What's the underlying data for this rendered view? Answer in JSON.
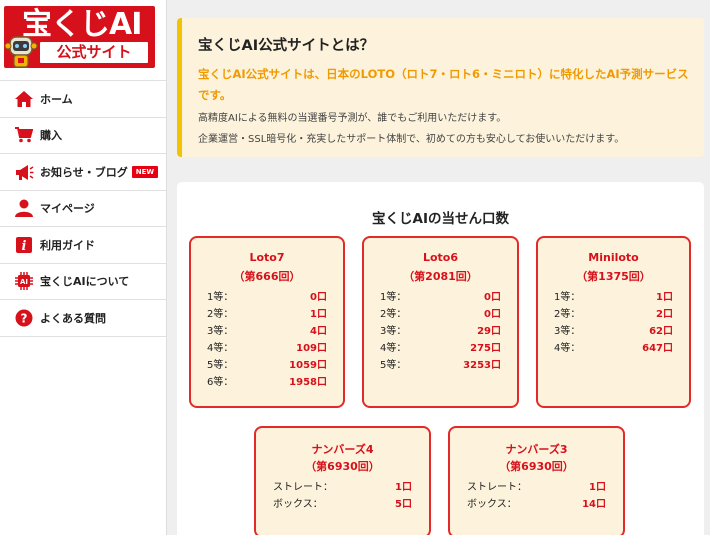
{
  "logo": {
    "main": "宝くじAI",
    "sub": "公式サイト"
  },
  "nav": [
    {
      "label": "ホーム",
      "icon": "home-icon"
    },
    {
      "label": "購入",
      "icon": "cart-icon"
    },
    {
      "label": "お知らせ・ブログ",
      "icon": "megaphone-icon",
      "badge": "NEW"
    },
    {
      "label": "マイページ",
      "icon": "user-icon"
    },
    {
      "label": "利用ガイド",
      "icon": "guide-book-icon"
    },
    {
      "label": "宝くじAIについて",
      "icon": "ai-chip-icon"
    },
    {
      "label": "よくある質問",
      "icon": "question-icon"
    }
  ],
  "intro": {
    "title": "宝くじAI公式サイトとは？",
    "lead": "宝くじAI公式サイトは、日本のLOTO（ロト7・ロト6・ミニロト）に特化したAI予測サービスです。",
    "text1": "高精度AIによる無料の当選番号予測が、誰でもご利用いただけます。",
    "text2": "企業運営・SSL暗号化・充実したサポート体制で、初めての方も安心してお使いいただけます。"
  },
  "winners": {
    "title": "宝くじAIの当せん口数",
    "cards": [
      {
        "name": "Loto7",
        "round": "（第666回）",
        "rows": [
          {
            "label": "1等：",
            "value": "0口"
          },
          {
            "label": "2等：",
            "value": "1口"
          },
          {
            "label": "3等：",
            "value": "4口"
          },
          {
            "label": "4等：",
            "value": "109口"
          },
          {
            "label": "5等：",
            "value": "1059口"
          },
          {
            "label": "6等：",
            "value": "1958口"
          }
        ]
      },
      {
        "name": "Loto6",
        "round": "（第2081回）",
        "rows": [
          {
            "label": "1等：",
            "value": "0口"
          },
          {
            "label": "2等：",
            "value": "0口"
          },
          {
            "label": "3等：",
            "value": "29口"
          },
          {
            "label": "4等：",
            "value": "275口"
          },
          {
            "label": "5等：",
            "value": "3253口"
          }
        ]
      },
      {
        "name": "Miniloto",
        "round": "（第1375回）",
        "rows": [
          {
            "label": "1等：",
            "value": "1口"
          },
          {
            "label": "2等：",
            "value": "2口"
          },
          {
            "label": "3等：",
            "value": "62口"
          },
          {
            "label": "4等：",
            "value": "647口"
          }
        ]
      },
      {
        "name": "ナンバーズ4",
        "round": "（第6930回）",
        "rows": [
          {
            "label": "ストレート：",
            "value": "1口"
          },
          {
            "label": "ボックス：",
            "value": "5口"
          }
        ]
      },
      {
        "name": "ナンバーズ3",
        "round": "（第6930回）",
        "rows": [
          {
            "label": "ストレート：",
            "value": "1口"
          },
          {
            "label": "ボックス：",
            "value": "14口"
          }
        ]
      }
    ]
  },
  "colors": {
    "brand_red": "#d7111b",
    "accent_orange": "#f19a00",
    "intro_bg": "#fdf3dc",
    "intro_bar": "#f3c300"
  }
}
